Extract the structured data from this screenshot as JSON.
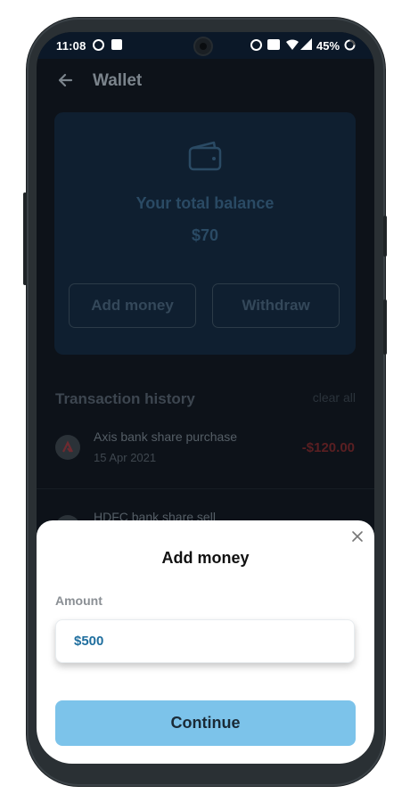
{
  "status_bar": {
    "time": "11:08",
    "battery_text": "45%",
    "icons": [
      "gb-icon",
      "gallery-icon",
      "alarm-icon",
      "volte-icon",
      "wifi-icon",
      "signal-icon",
      "battery-icon"
    ]
  },
  "header": {
    "title": "Wallet",
    "back_icon": "arrow-left-icon"
  },
  "balance_card": {
    "icon": "wallet-icon",
    "label": "Your total balance",
    "value": "$70",
    "add_money_label": "Add money",
    "withdraw_label": "Withdraw"
  },
  "transactions": {
    "title": "Transaction history",
    "clear_all": "clear all",
    "items": [
      {
        "name": "Axis bank share purchase",
        "date": "15 Apr 2021",
        "amount": "-$120.00"
      },
      {
        "name": "HDFC bank share sell",
        "date": "",
        "amount": ""
      }
    ]
  },
  "sheet": {
    "title": "Add money",
    "amount_label": "Amount",
    "amount_value": "$500",
    "continue_label": "Continue",
    "close_icon": "close-icon"
  },
  "colors": {
    "accent": "#7cc3ea",
    "amount_text": "#1f6e9e",
    "negative_amount": "#c0392b"
  }
}
